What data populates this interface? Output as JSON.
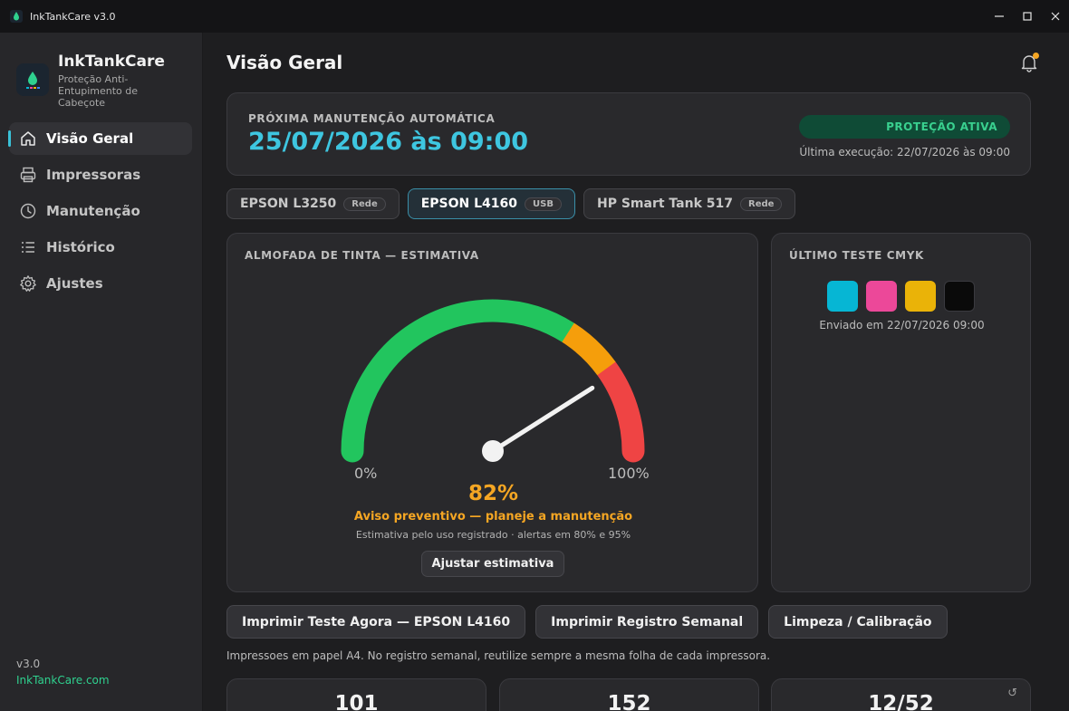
{
  "window": {
    "title": "InkTankCare v3.0"
  },
  "sidebar": {
    "brand_name": "InkTankCare",
    "brand_subtitle": "Proteção Anti-Entupimento de Cabeçote",
    "items": [
      {
        "label": "Visão Geral",
        "icon": "home-icon",
        "active": true
      },
      {
        "label": "Impressoras",
        "icon": "printer-icon",
        "active": false
      },
      {
        "label": "Manutenção",
        "icon": "clock-icon",
        "active": false
      },
      {
        "label": "Histórico",
        "icon": "list-icon",
        "active": false
      },
      {
        "label": "Ajustes",
        "icon": "gear-icon",
        "active": false
      }
    ],
    "version": "v3.0",
    "website": "InkTankCare.com"
  },
  "header": {
    "title": "Visão Geral"
  },
  "next_maintenance": {
    "label": "PRÓXIMA MANUTENÇÃO AUTOMÁTICA",
    "datetime": "25/07/2026 às 09:00",
    "status_badge": "PROTEÇÃO ATIVA",
    "last_run": "Última execução: 22/07/2026 às 09:00"
  },
  "printers": [
    {
      "name": "EPSON L3250",
      "connection": "Rede",
      "selected": false
    },
    {
      "name": "EPSON L4160",
      "connection": "USB",
      "selected": true
    },
    {
      "name": "HP Smart Tank 517",
      "connection": "Rede",
      "selected": false
    }
  ],
  "ink_pad": {
    "title": "ALMOFADA DE TINTA — ESTIMATIVA",
    "value": 82,
    "value_text": "82%",
    "min_label": "0%",
    "max_label": "100%",
    "warning": "Aviso preventivo — planeje a manutenção",
    "note": "Estimativa pelo uso registrado · alertas em 80% e 95%",
    "adjust_button": "Ajustar estimativa",
    "colors": {
      "green": "#22c55e",
      "orange": "#f59e0b",
      "red": "#ef4444"
    }
  },
  "cmyk_test": {
    "title": "ÚLTIMO TESTE CMYK",
    "swatches": [
      "#06b6d4",
      "#ec4899",
      "#eab308",
      "#0a0a0a"
    ],
    "sent": "Enviado em 22/07/2026 09:00"
  },
  "actions": {
    "print_test": "Imprimir Teste Agora — EPSON L4160",
    "print_weekly": "Imprimir Registro Semanal",
    "cleaning": "Limpeza / Calibração"
  },
  "hint": "Impressoes em papel A4. No registro semanal, reutilize sempre a mesma folha de cada impressora.",
  "stats": [
    {
      "value": "101"
    },
    {
      "value": "152"
    },
    {
      "value": "12/52"
    }
  ]
}
